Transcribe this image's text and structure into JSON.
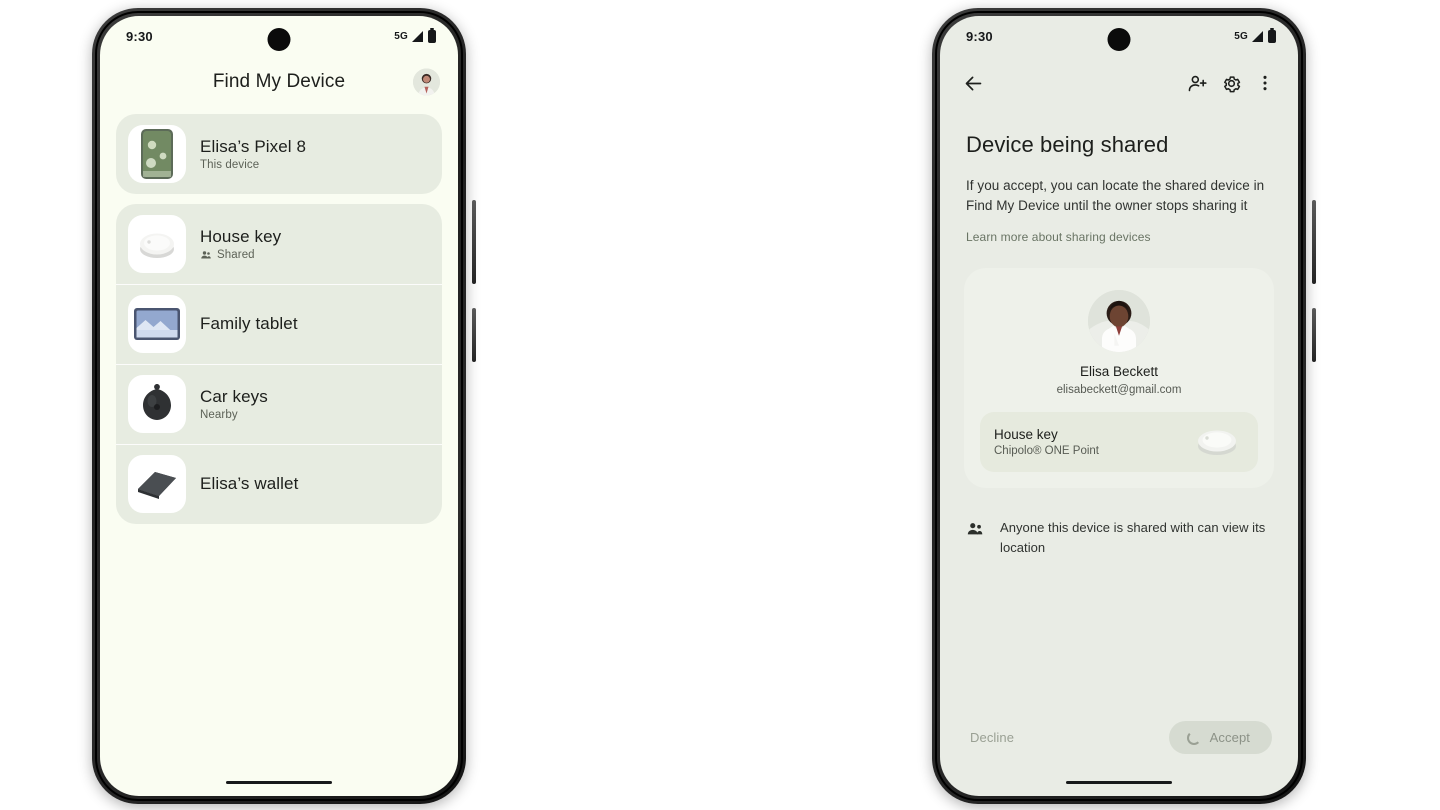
{
  "left_phone": {
    "status_bar": {
      "time": "9:30",
      "network": "5G",
      "signal_icon": "signal-bars-icon",
      "battery_icon": "battery-icon"
    },
    "app_bar": {
      "title": "Find My Device",
      "avatar_icon": "account-avatar"
    },
    "devices": [
      {
        "name": "Elisa’s Pixel 8",
        "subtitle": "This device",
        "sub_icon": null,
        "thumb": "phone-thumbnail"
      },
      {
        "name": "House key",
        "subtitle": "Shared",
        "sub_icon": "people-shared-icon",
        "thumb": "tracker-tag-thumbnail"
      },
      {
        "name": "Family tablet",
        "subtitle": null,
        "sub_icon": null,
        "thumb": "tablet-thumbnail"
      },
      {
        "name": "Car keys",
        "subtitle": "Nearby",
        "sub_icon": null,
        "thumb": "key-fob-thumbnail"
      },
      {
        "name": "Elisa’s wallet",
        "subtitle": null,
        "sub_icon": null,
        "thumb": "wallet-thumbnail"
      }
    ]
  },
  "right_phone": {
    "status_bar": {
      "time": "9:30",
      "network": "5G",
      "signal_icon": "signal-bars-icon",
      "battery_icon": "battery-icon"
    },
    "top_actions": {
      "back_icon": "back-arrow-icon",
      "add_person_icon": "person-add-icon",
      "settings_icon": "gear-icon",
      "overflow_icon": "more-vertical-icon"
    },
    "content": {
      "title": "Device being shared",
      "description": "If you accept, you can locate the shared device in Find My Device until the owner stops sharing it",
      "learn_more": "Learn more about sharing devices"
    },
    "share_card": {
      "avatar_icon": "person-photo-avatar",
      "person_name": "Elisa Beckett",
      "person_email": "elisabeckett@gmail.com",
      "device": {
        "name": "House key",
        "model": "Chipolo® ONE Point",
        "thumb": "tracker-tag-thumbnail"
      }
    },
    "notice": {
      "icon": "people-group-icon",
      "text": "Anyone this device is shared with can view its location"
    },
    "actions": {
      "decline_label": "Decline",
      "accept_label": "Accept",
      "accept_spinner": "loading-spinner-icon"
    }
  },
  "colors": {
    "page_background": "#ffffff",
    "left_screen_bg": "#fafdf2",
    "right_screen_bg": "#e9ece5",
    "card_bg": "#e7ece1",
    "text_primary": "#1d1f1c",
    "text_secondary": "#5d6257",
    "disabled_text": "#9aa094",
    "accept_bg": "#d6dbd1"
  }
}
